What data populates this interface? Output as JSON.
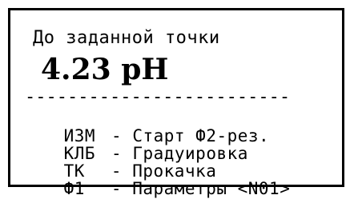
{
  "display": {
    "title": "До заданной точки",
    "reading": "4.23 pH",
    "divider": "-------------------------",
    "menu": [
      {
        "key": "ИЗМ",
        "separator": "-",
        "action": "Старт Ф2-рез."
      },
      {
        "key": "КЛБ",
        "separator": "-",
        "action": "Градуировка"
      },
      {
        "key": "ТК",
        "separator": "-",
        "action": "Прокачка"
      },
      {
        "key": "Ф1",
        "separator": "-",
        "action": "Параметры <N01>"
      }
    ]
  }
}
